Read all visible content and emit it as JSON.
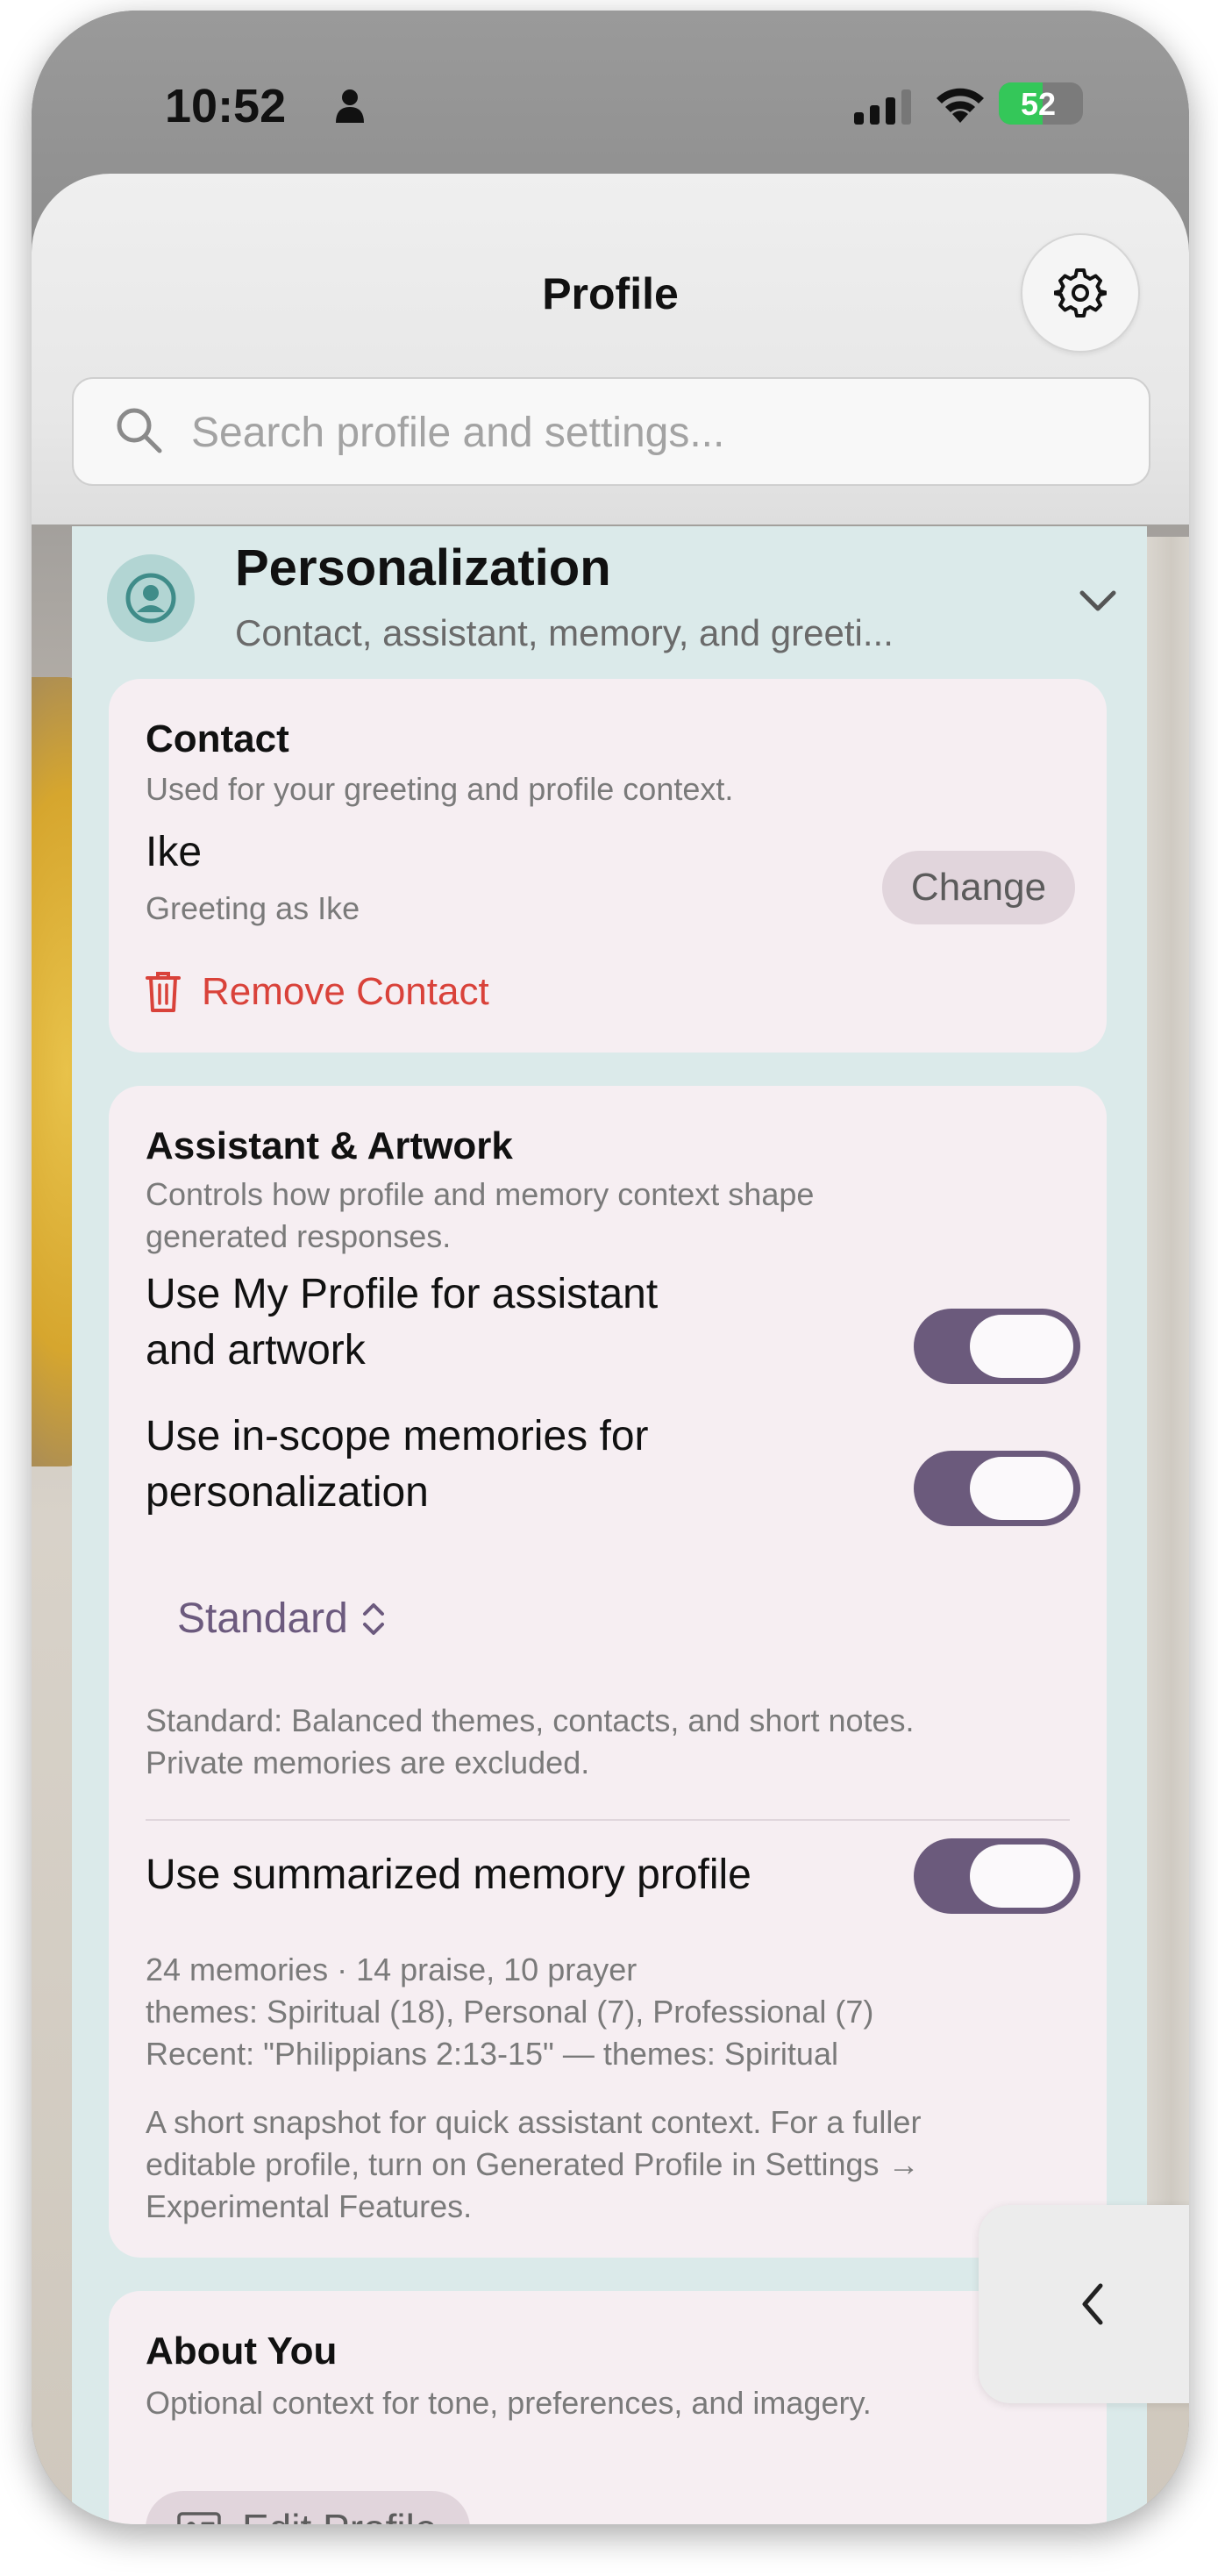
{
  "status_bar": {
    "time": "10:52",
    "battery": "52"
  },
  "header": {
    "title": "Profile",
    "settings_icon": "gear-icon"
  },
  "search": {
    "placeholder": "Search profile and settings..."
  },
  "section": {
    "title": "Personalization",
    "subtitle": "Contact, assistant, memory, and greeti..."
  },
  "contact": {
    "title": "Contact",
    "description": "Used for your greeting and profile context.",
    "name": "Ike",
    "greeting": "Greeting as Ike",
    "change_label": "Change",
    "remove_label": "Remove Contact"
  },
  "assistant": {
    "title": "Assistant & Artwork",
    "description_line1": "Controls how profile and memory context shape",
    "description_line2": "generated responses.",
    "toggle1_line1": "Use My Profile for assistant",
    "toggle1_line2": "and artwork",
    "toggle1_on": true,
    "toggle2_line1": "Use in-scope memories for",
    "toggle2_line2": "personalization",
    "toggle2_on": true,
    "mode_selected": "Standard",
    "mode_desc_line1": "Standard: Balanced themes, contacts, and short notes.",
    "mode_desc_line2": "Private memories are excluded.",
    "toggle3_label": "Use summarized memory profile",
    "toggle3_on": true,
    "summary_line1": "24 memories · 14 praise, 10 prayer",
    "summary_line2": "themes: Spiritual (18), Personal (7), Professional (7)",
    "summary_line3": "Recent: \"Philippians 2:13-15\" — themes: Spiritual",
    "note_line1": "A short snapshot for quick assistant context. For a fuller",
    "note_line2": "editable profile, turn on Generated Profile in Settings →",
    "note_line3": "Experimental Features."
  },
  "about": {
    "title": "About You",
    "description": "Optional context for tone, preferences, and imagery.",
    "edit_label": "Edit Profile"
  }
}
